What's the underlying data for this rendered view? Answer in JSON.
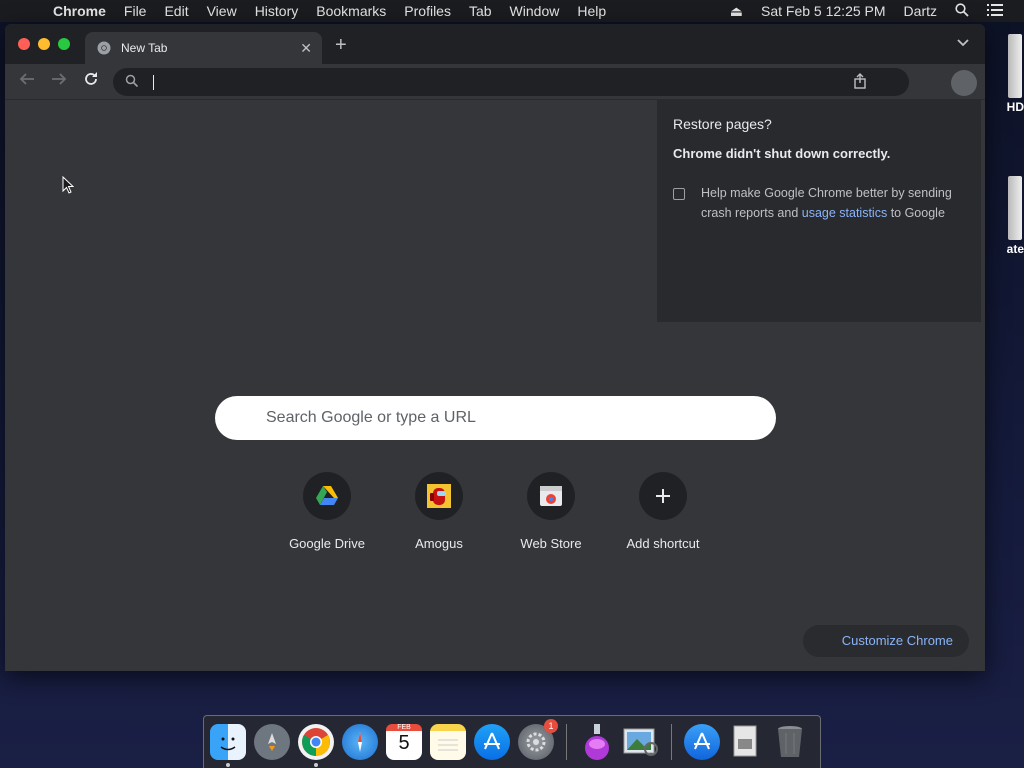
{
  "menubar": {
    "app_name": "Chrome",
    "items": [
      "File",
      "Edit",
      "View",
      "History",
      "Bookmarks",
      "Profiles",
      "Tab",
      "Window",
      "Help"
    ],
    "datetime": "Sat Feb 5  12:25 PM",
    "user": "Dartz"
  },
  "desktop": {
    "drive1_label": "HD",
    "drive2_label": "ate"
  },
  "tab": {
    "title": "New Tab"
  },
  "omnibox": {
    "value": ""
  },
  "restore_panel": {
    "title": "Restore pages?",
    "message": "Chrome didn't shut down correctly.",
    "checkbox_text": "Help make Google Chrome better by sending crash reports and ",
    "checkbox_link": "usage statistics",
    "checkbox_suffix": " to Google",
    "checked": false
  },
  "search": {
    "placeholder": "Search Google or type a URL"
  },
  "shortcuts": [
    {
      "label": "Google Drive",
      "icon": "google-drive-icon"
    },
    {
      "label": "Amogus",
      "icon": "amogus-icon"
    },
    {
      "label": "Web Store",
      "icon": "web-store-icon"
    },
    {
      "label": "Add shortcut",
      "icon": "plus-icon"
    }
  ],
  "customize": {
    "label": "Customize Chrome"
  },
  "dock": {
    "calendar_month": "FEB",
    "calendar_day": "5",
    "sysprefs_badge": "1",
    "apps": [
      "finder",
      "launchpad",
      "chrome",
      "safari",
      "calendar",
      "notes",
      "app-store",
      "system-preferences",
      "downloads",
      "preview",
      "app-store-folder",
      "documents",
      "trash"
    ]
  },
  "colors": {
    "accent_link": "#8ab4f8",
    "window_bg": "#35363a",
    "tabstrip_bg": "#202124",
    "close": "#ff5f57",
    "minimize": "#febc2e",
    "maximize": "#28c840"
  }
}
